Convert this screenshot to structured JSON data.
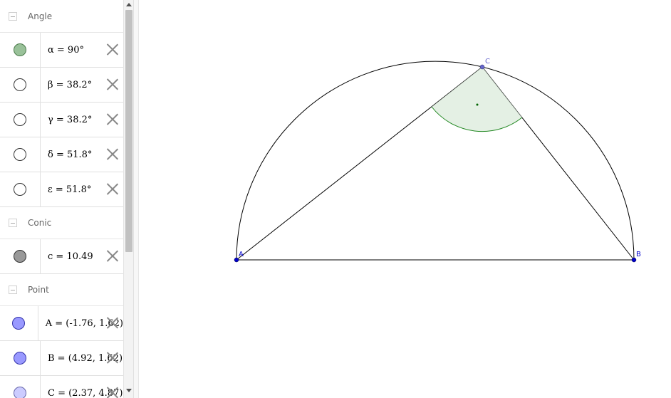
{
  "algebra": {
    "groups": {
      "angle": {
        "title": "Angle",
        "items": [
          {
            "text": "α = 90°",
            "color": "#99c199",
            "filled": true
          },
          {
            "text": "β = 38.2°",
            "color": "#ffffff",
            "filled": false
          },
          {
            "text": "γ = 38.2°",
            "color": "#ffffff",
            "filled": false
          },
          {
            "text": "δ = 51.8°",
            "color": "#ffffff",
            "filled": false
          },
          {
            "text": "ε = 51.8°",
            "color": "#ffffff",
            "filled": false
          }
        ]
      },
      "conic": {
        "title": "Conic",
        "items": [
          {
            "text": "c = 10.49",
            "color": "#999999",
            "filled": true
          }
        ]
      },
      "point": {
        "title": "Point",
        "items": [
          {
            "text": "A = (-1.76, 1.62)",
            "color": "#9999ff",
            "filled": true
          },
          {
            "text": "B = (4.92, 1.62)",
            "color": "#9999ff",
            "filled": true
          },
          {
            "text": "C = (2.37, 4.87)",
            "color": "#ccccff",
            "filled": true
          }
        ]
      }
    }
  },
  "graphics": {
    "points": {
      "A": {
        "label": "A",
        "color": "#0000cc"
      },
      "B": {
        "label": "B",
        "color": "#0000cc"
      },
      "C": {
        "label": "C",
        "color": "#6666cc"
      }
    },
    "angle_fill": "#d9ead9",
    "angle_stroke": "#228822"
  }
}
